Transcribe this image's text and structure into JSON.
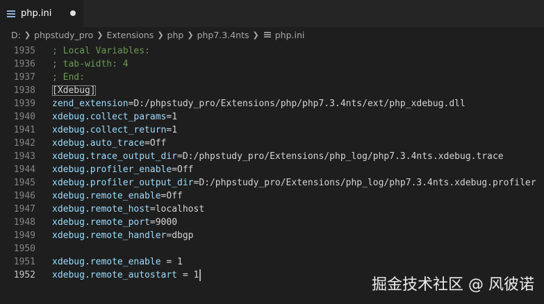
{
  "tab": {
    "label": "php.ini",
    "icon": "settings-file-icon"
  },
  "breadcrumb": {
    "items": [
      "D:",
      "phpstudy_pro",
      "Extensions",
      "php",
      "php7.3.4nts",
      "php.ini"
    ]
  },
  "editor": {
    "lines": [
      {
        "n": "1935",
        "key": "",
        "eq": "",
        "val": "",
        "comment": "; Local Variables:"
      },
      {
        "n": "1936",
        "key": "",
        "eq": "",
        "val": "",
        "comment": "; tab-width: 4"
      },
      {
        "n": "1937",
        "key": "",
        "eq": "",
        "val": "",
        "comment": "; End:"
      },
      {
        "n": "1938",
        "section": "[Xdebug]"
      },
      {
        "n": "1939",
        "key": "zend_extension",
        "eq": "=",
        "val": "D:/phpstudy_pro/Extensions/php/php7.3.4nts/ext/php_xdebug.dll"
      },
      {
        "n": "1940",
        "key": "xdebug.collect_params",
        "eq": "=",
        "val": "1"
      },
      {
        "n": "1941",
        "key": "xdebug.collect_return",
        "eq": "=",
        "val": "1"
      },
      {
        "n": "1942",
        "key": "xdebug.auto_trace",
        "eq": "=",
        "val": "Off"
      },
      {
        "n": "1943",
        "key": "xdebug.trace_output_dir",
        "eq": "=",
        "val": "D:/phpstudy_pro/Extensions/php_log/php7.3.4nts.xdebug.trace"
      },
      {
        "n": "1944",
        "key": "xdebug.profiler_enable",
        "eq": "=",
        "val": "Off"
      },
      {
        "n": "1945",
        "key": "xdebug.profiler_output_dir",
        "eq": "=",
        "val": "D:/phpstudy_pro/Extensions/php_log/php7.3.4nts.xdebug.profiler"
      },
      {
        "n": "1946",
        "key": "xdebug.remote_enable",
        "eq": "=",
        "val": "Off"
      },
      {
        "n": "1947",
        "key": "xdebug.remote_host",
        "eq": "=",
        "val": "localhost"
      },
      {
        "n": "1948",
        "key": "xdebug.remote_port",
        "eq": "=",
        "val": "9000"
      },
      {
        "n": "1949",
        "key": "xdebug.remote_handler",
        "eq": "=",
        "val": "dbgp"
      },
      {
        "n": "1950",
        "key": "",
        "eq": "",
        "val": ""
      },
      {
        "n": "1951",
        "key": "xdebug.remote_enable",
        "eq": " = ",
        "val": "1"
      },
      {
        "n": "1952",
        "key": "xdebug.remote_autostart",
        "eq": " = ",
        "val": "1"
      }
    ]
  },
  "watermark": "掘金技术社区 @ 风彼诺",
  "colors": {
    "background": "#1e1e1e",
    "comment": "#6a9955",
    "key": "#9cdcfe",
    "text": "#d4d4d4",
    "line_number": "#858585"
  }
}
